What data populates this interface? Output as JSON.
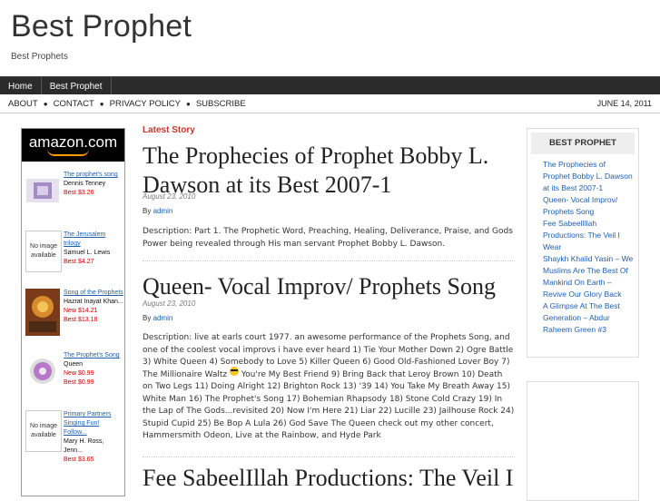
{
  "site": {
    "title": "Best Prophet",
    "description": "Best Prophets"
  },
  "nav": {
    "items": [
      "Home",
      "Best Prophet"
    ]
  },
  "subnav": {
    "links": [
      "ABOUT",
      "CONTACT",
      "PRIVACY POLICY",
      "SUBSCRIBE"
    ],
    "date": "JUNE 14, 2011"
  },
  "amazon": {
    "logo": "amazon.com",
    "items": [
      {
        "title": "The prophet's song",
        "author": "Dennis Tenney",
        "prices": [
          "Best $3.26"
        ],
        "thumb": ""
      },
      {
        "title": "The Jerusalem trilogy",
        "author": "Samuel L. Lewis",
        "prices": [
          "Best $4.27"
        ],
        "thumb": "No image available"
      },
      {
        "title": "Song of the Prophets",
        "author": "Hazrat Inayat Khan...",
        "prices": [
          "New $14.21",
          "Best $13.18"
        ],
        "thumb": ""
      },
      {
        "title": "The Prophet's Song",
        "author": "Queen",
        "prices": [
          "New $0.99",
          "Best $0.99"
        ],
        "thumb": ""
      },
      {
        "title": "Primary Partners Singing Fun! Follow...",
        "author": "Mary H. Ross, Jenn...",
        "prices": [
          "Best $3.65"
        ],
        "thumb": "No image available"
      }
    ]
  },
  "main": {
    "section_label": "Latest Story",
    "posts": [
      {
        "title": "The Prophecies of Prophet Bobby L. Dawson at its Best 2007-1",
        "date": "August 23, 2010",
        "by": "By",
        "author": "admin",
        "body": "Description: Part 1. The Prophetic Word, Preaching, Healing, Deliverance, Praise, and Gods Power being revealed through His man servant Prophet Bobby L. Dawson."
      },
      {
        "title": "Queen- Vocal Improv/ Prophets Song",
        "date": "August 23, 2010",
        "by": "By",
        "author": "admin",
        "body_before": "Description: live at earls court 1977. an awesome performance of the Prophets Song, and one of the coolest vocal improvs i have ever heard 1) Tie Your Mother Down 2) Ogre Battle 3) White Queen 4) Somebody to Love 5) Killer Queen 6) Good Old-Fashioned Lover Boy 7) The Millionaire Waltz",
        "body_after": " You're My Best Friend 9) Bring Back that Leroy Brown 10) Death on Two Legs 11) Doing Alright 12) Brighton Rock 13) '39 14) You Take My Breath Away 15) White Man 16) The Prophet's Song 17) Bohemian Rhapsody 18) Stone Cold Crazy 19) In the Lap of The Gods...revisited 20) Now I'm Here 21) Liar 22) Lucille 23) Jailhouse Rock 24) Stupid Cupid 25) Be Bop A Lula 26) God Save The Queen check out my other concert, Hammersmith Odeon, Live at the Rainbow, and Hyde Park"
      },
      {
        "title": "Fee SabeelIllah Productions: The Veil I"
      }
    ]
  },
  "sidebar": {
    "heading": "BEST PROPHET",
    "links": [
      "The Prophecies of Prophet Bobby L. Dawson at its Best 2007-1",
      "Queen- Vocal Improv/ Prophets Song",
      "Fee SabeelIllah Productions: The Veil I Wear",
      "Shaykh Khalid Yasin – We Muslims Are The Best Of Mankind On Earth – Revive Our Glory Back",
      "A Glimpse At The Best Generation – Abdur Raheem Green #3"
    ]
  },
  "colors": {
    "nav_bg": "#2b2b2b",
    "accent": "#c0392b",
    "link": "#1e5fb0"
  }
}
